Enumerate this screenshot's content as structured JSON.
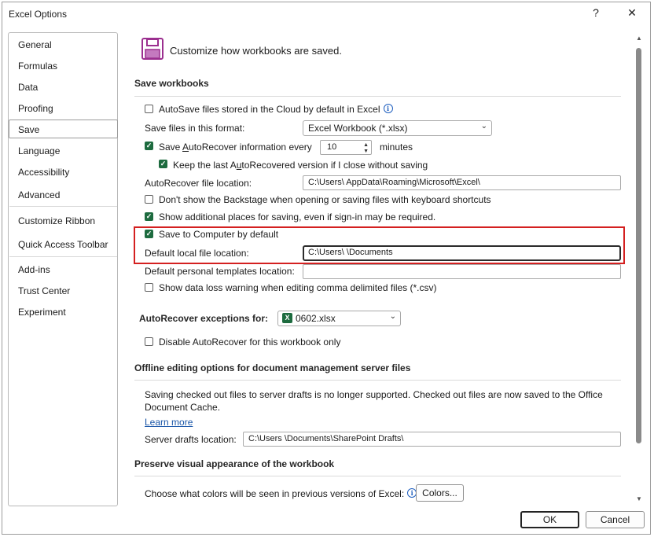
{
  "window": {
    "title": "Excel Options",
    "help_label": "?",
    "close_label": "✕"
  },
  "nav": {
    "items": [
      {
        "label": "General"
      },
      {
        "label": "Formulas"
      },
      {
        "label": "Data"
      },
      {
        "label": "Proofing"
      },
      {
        "label": "Save"
      },
      {
        "label": "Language"
      },
      {
        "label": "Accessibility"
      },
      {
        "label": "Advanced"
      },
      {
        "label": "Customize Ribbon"
      },
      {
        "label": "Quick Access Toolbar"
      },
      {
        "label": "Add-ins"
      },
      {
        "label": "Trust Center"
      },
      {
        "label": "Experiment"
      }
    ],
    "selected": "Save"
  },
  "page": {
    "heading": "Customize how workbooks are saved."
  },
  "save_workbooks": {
    "header": "Save workbooks",
    "autosave_label": "AutoSave files stored in the Cloud by default in Excel",
    "autosave_checked": false,
    "format_label": "Save files in this format:",
    "format_value": "Excel Workbook (*.xlsx)",
    "autorecover_pre": "Save ",
    "autorecover_u": "A",
    "autorecover_post": "utoRecover information every",
    "autorecover_checked": true,
    "autorecover_minutes": "10",
    "minutes_label": "minutes",
    "keep_pre": "Keep the last A",
    "keep_u": "u",
    "keep_post": "toRecovered version if I close without saving",
    "keep_checked": true,
    "ar_location_label": "AutoRecover file location:",
    "ar_location_value": "C:\\Users\\              AppData\\Roaming\\Microsoft\\Excel\\",
    "backstage_label": "Don't show the Backstage when opening or saving files with keyboard shortcuts",
    "backstage_checked": false,
    "additional_places_label": "Show additional places for saving, even if sign-in may be required.",
    "additional_places_checked": true,
    "save_computer_label": "Save to Computer by default",
    "save_computer_checked": true,
    "local_location_label": "Default local file location:",
    "local_location_value": "C:\\Users\\              \\Documents",
    "templates_label": "Default personal templates location:",
    "templates_value": "",
    "dataloss_label": "Show data loss warning when editing comma delimited files (*.csv)",
    "dataloss_checked": false
  },
  "autorecover_exceptions": {
    "label": "AutoRecover exceptions for:",
    "workbook": "0602.xlsx",
    "disable_label": "Disable AutoRecover for this workbook only",
    "disable_checked": false
  },
  "offline": {
    "header": "Offline editing options for document management server files",
    "text_line1": "Saving checked out files to server drafts is no longer supported. Checked out files are now saved to the Office",
    "text_line2": "Document Cache.",
    "learn_more": "Learn more",
    "drafts_label": "Server drafts location:",
    "drafts_value": "C:\\Users               \\Documents\\SharePoint Drafts\\"
  },
  "preserve": {
    "header": "Preserve visual appearance of the workbook",
    "colors_label": "Choose what colors will be seen in previous versions of Excel:",
    "colors_button": "Colors..."
  },
  "footer": {
    "ok": "OK",
    "cancel": "Cancel"
  },
  "colors": {
    "accent_green": "#1d6b3f",
    "highlight_red": "#d42020",
    "link_blue": "#1a56a8"
  }
}
